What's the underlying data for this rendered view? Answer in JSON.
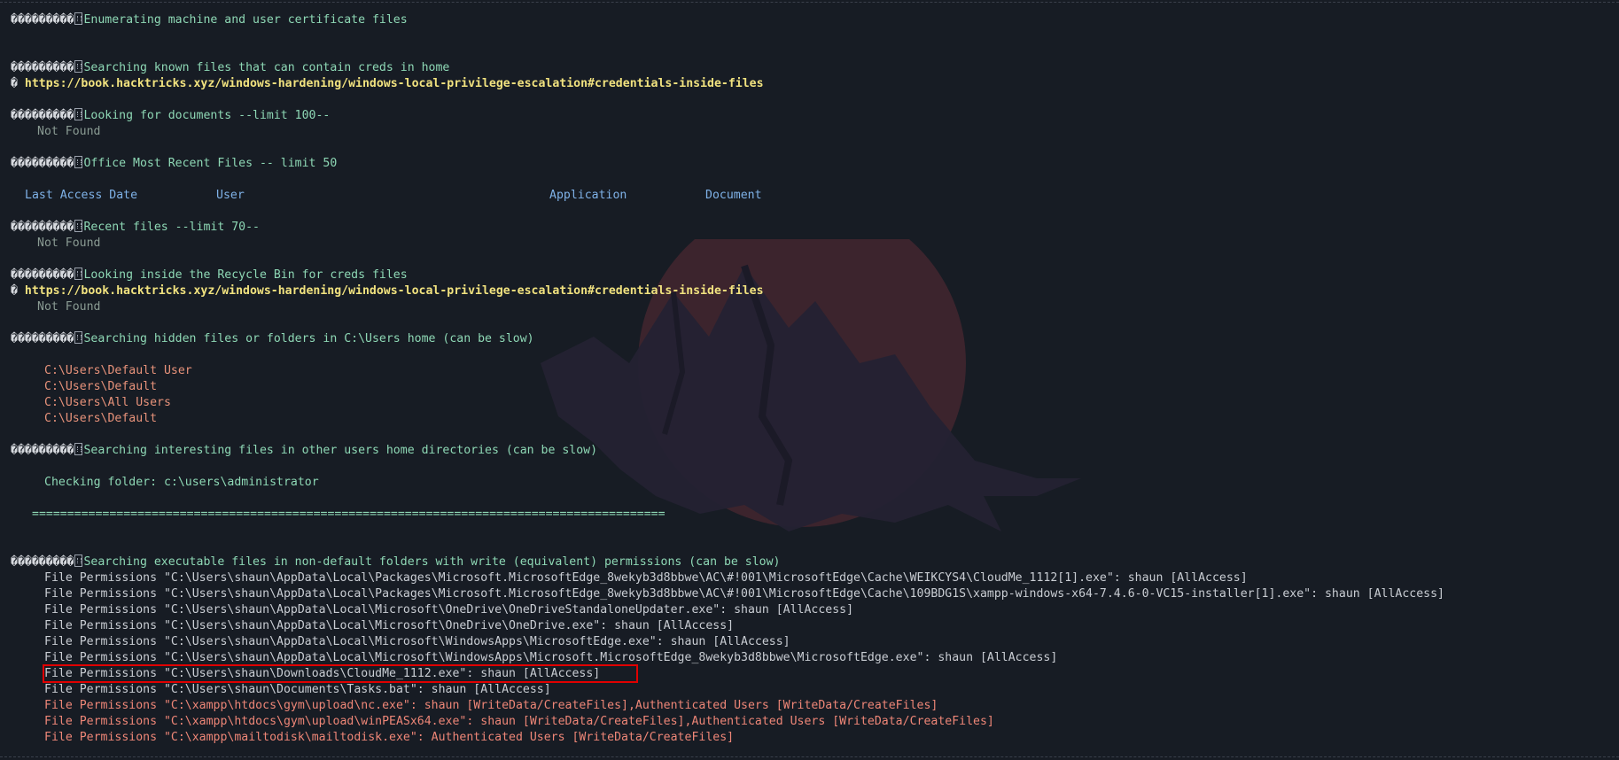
{
  "lines": {
    "l1": "Enumerating machine and user certificate files",
    "l2": "Searching known files that can contain creds in home",
    "l3_link": "https://book.hacktricks.xyz/windows-hardening/windows-local-privilege-escalation#credentials-inside-files",
    "l4": "Looking for documents --limit 100--",
    "l5": "Not Found",
    "l6": "Office Most Recent Files -- limit 50",
    "office_headers": [
      "Last Access Date",
      "User",
      "Application",
      "Document"
    ],
    "l7": "Recent files --limit 70--",
    "l8": "Not Found",
    "l9": "Looking inside the Recycle Bin for creds files",
    "l10_link": "https://book.hacktricks.xyz/windows-hardening/windows-local-privilege-escalation#credentials-inside-files",
    "l11": "Not Found",
    "l12": "Searching hidden files or folders in C:\\Users home (can be slow)",
    "hidden_paths": [
      "C:\\Users\\Default User",
      "C:\\Users\\Default",
      "C:\\Users\\All Users",
      "C:\\Users\\Default"
    ],
    "l13": "Searching interesting files in other users home directories (can be slow)",
    "l14": "Checking folder: c:\\users\\administrator",
    "separator": "==========================================================================================",
    "l15": "Searching executable files in non-default folders with write (equivalent) permissions (can be slow)",
    "perms_normal": [
      "File Permissions \"C:\\Users\\shaun\\AppData\\Local\\Packages\\Microsoft.MicrosoftEdge_8wekyb3d8bbwe\\AC\\#!001\\MicrosoftEdge\\Cache\\WEIKCYS4\\CloudMe_1112[1].exe\": shaun [AllAccess]",
      "File Permissions \"C:\\Users\\shaun\\AppData\\Local\\Packages\\Microsoft.MicrosoftEdge_8wekyb3d8bbwe\\AC\\#!001\\MicrosoftEdge\\Cache\\109BDG1S\\xampp-windows-x64-7.4.6-0-VC15-installer[1].exe\": shaun [AllAccess]",
      "File Permissions \"C:\\Users\\shaun\\AppData\\Local\\Microsoft\\OneDrive\\OneDriveStandaloneUpdater.exe\": shaun [AllAccess]",
      "File Permissions \"C:\\Users\\shaun\\AppData\\Local\\Microsoft\\OneDrive\\OneDrive.exe\": shaun [AllAccess]",
      "File Permissions \"C:\\Users\\shaun\\AppData\\Local\\Microsoft\\WindowsApps\\MicrosoftEdge.exe\": shaun [AllAccess]",
      "File Permissions \"C:\\Users\\shaun\\AppData\\Local\\Microsoft\\WindowsApps\\Microsoft.MicrosoftEdge_8wekyb3d8bbwe\\MicrosoftEdge.exe\": shaun [AllAccess]",
      "File Permissions \"C:\\Users\\shaun\\Downloads\\CloudMe_1112.exe\": shaun [AllAccess]",
      "File Permissions \"C:\\Users\\shaun\\Documents\\Tasks.bat\": shaun [AllAccess]"
    ],
    "perms_warn": [
      "File Permissions \"C:\\xampp\\htdocs\\gym\\upload\\nc.exe\": shaun [WriteData/CreateFiles],Authenticated Users [WriteData/CreateFiles]",
      "File Permissions \"C:\\xampp\\htdocs\\gym\\upload\\winPEASx64.exe\": shaun [WriteData/CreateFiles],Authenticated Users [WriteData/CreateFiles]",
      "File Permissions \"C:\\xampp\\mailtodisk\\mailtodisk.exe\": Authenticated Users [WriteData/CreateFiles]"
    ]
  },
  "colors": {
    "background": "#171c24",
    "section": "#8ed8b5",
    "link": "#f1e27f",
    "path": "#e7927a",
    "header": "#7fb2e8",
    "warn": "#ee8677",
    "highlight_box": "#e00000"
  },
  "icons": {
    "section_marker": "broken-glyph-icon",
    "link_marker": "link-icon"
  }
}
